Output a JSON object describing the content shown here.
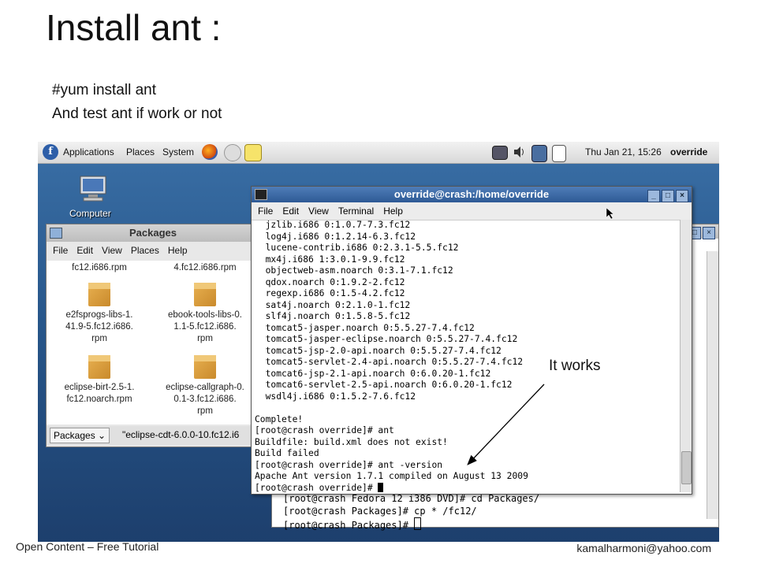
{
  "slide": {
    "title": "Install ant :",
    "notes": [
      "#yum install ant",
      "And test ant if work or not"
    ],
    "annotation": "It works",
    "footer_left": "Open Content – Free Tutorial",
    "footer_right": "kamalharmoni@yahoo.com"
  },
  "panel": {
    "menus": [
      "Applications",
      "Places",
      "System"
    ],
    "clock": "Thu Jan 21, 15:26",
    "user": "override",
    "icons": [
      "fedora-logo-icon",
      "firefox-icon",
      "network-icon",
      "notes-icon",
      "display-icon",
      "volume-icon",
      "network-status-icon",
      "update-icon"
    ]
  },
  "desktop": {
    "computer_label": "Computer"
  },
  "file_manager": {
    "title": "Packages",
    "menu": [
      "File",
      "Edit",
      "View",
      "Places",
      "Help"
    ],
    "items": [
      {
        "name": "fc12.i686.rpm",
        "partial": true
      },
      {
        "name": "4.fc12.i686.rpm",
        "partial": true
      },
      {
        "name": "e2fsprogs-libs-1.\n41.9-5.fc12.i686.\nrpm"
      },
      {
        "name": "ebook-tools-libs-0.\n1.1-5.fc12.i686.\nrpm"
      },
      {
        "name": "eclipse-birt-2.5-1.\nfc12.noarch.rpm"
      },
      {
        "name": "eclipse-callgraph-0.\n0.1-3.fc12.i686.\nrpm"
      }
    ],
    "location_button": "Packages ⌄",
    "location_text": "\"eclipse-cdt-6.0.0-10.fc12.i6"
  },
  "back_terminal": {
    "lines": [
      "[root@crash Fedora 12 i386 DVD]# cd Packages/",
      "[root@crash Packages]# cp * /fc12/",
      "[root@crash Packages]# "
    ]
  },
  "terminal": {
    "title": "override@crash:/home/override",
    "menu": [
      "File",
      "Edit",
      "View",
      "Terminal",
      "Help"
    ],
    "lines": [
      "  jzlib.i686 0:1.0.7-7.3.fc12",
      "  log4j.i686 0:1.2.14-6.3.fc12",
      "  lucene-contrib.i686 0:2.3.1-5.5.fc12",
      "  mx4j.i686 1:3.0.1-9.9.fc12",
      "  objectweb-asm.noarch 0:3.1-7.1.fc12",
      "  qdox.noarch 0:1.9.2-2.fc12",
      "  regexp.i686 0:1.5-4.2.fc12",
      "  sat4j.noarch 0:2.1.0-1.fc12",
      "  slf4j.noarch 0:1.5.8-5.fc12",
      "  tomcat5-jasper.noarch 0:5.5.27-7.4.fc12",
      "  tomcat5-jasper-eclipse.noarch 0:5.5.27-7.4.fc12",
      "  tomcat5-jsp-2.0-api.noarch 0:5.5.27-7.4.fc12",
      "  tomcat5-servlet-2.4-api.noarch 0:5.5.27-7.4.fc12",
      "  tomcat6-jsp-2.1-api.noarch 0:6.0.20-1.fc12",
      "  tomcat6-servlet-2.5-api.noarch 0:6.0.20-1.fc12",
      "  wsdl4j.i686 0:1.5.2-7.6.fc12",
      "",
      "Complete!",
      "[root@crash override]# ant",
      "Buildfile: build.xml does not exist!",
      "Build failed",
      "[root@crash override]# ant -version",
      "Apache Ant version 1.7.1 compiled on August 13 2009",
      "[root@crash override]# "
    ]
  }
}
